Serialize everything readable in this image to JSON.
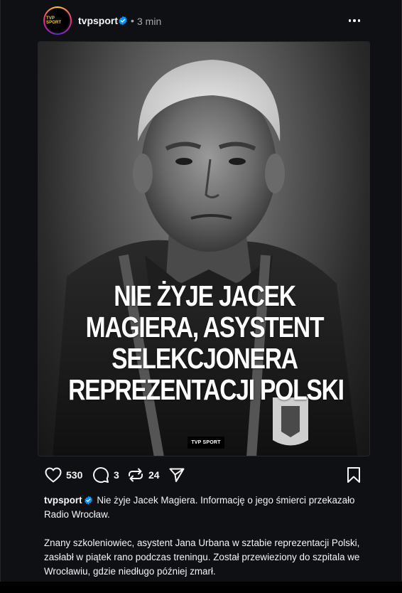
{
  "post": {
    "username": "tvpsport",
    "dot": "•",
    "time": "3 min",
    "avatar_text": "TVP SPORT",
    "accent": "#0095f6"
  },
  "image": {
    "headline_lines": [
      "NIE ŻYJE JACEK",
      "MAGIERA, ASYSTENT",
      "SELEKCJONERA",
      "REPREZENTACJI POLSKI"
    ],
    "badge": "TVP SPORT"
  },
  "actions": {
    "likes": "530",
    "comments": "3",
    "reposts": "24"
  },
  "caption": {
    "username": "tvpsport",
    "paragraph1": "Nie żyje Jacek Magiera. Informację o jego śmierci przekazało Radio Wrocław.",
    "paragraph2": "Znany szkoleniowiec, asystent Jana Urbana w sztabie reprezentacji Polski, zasłabł w piątek rano podczas treningu. Został przewieziony do szpitala we Wrocławiu, gdzie niedługo później zmarł."
  }
}
